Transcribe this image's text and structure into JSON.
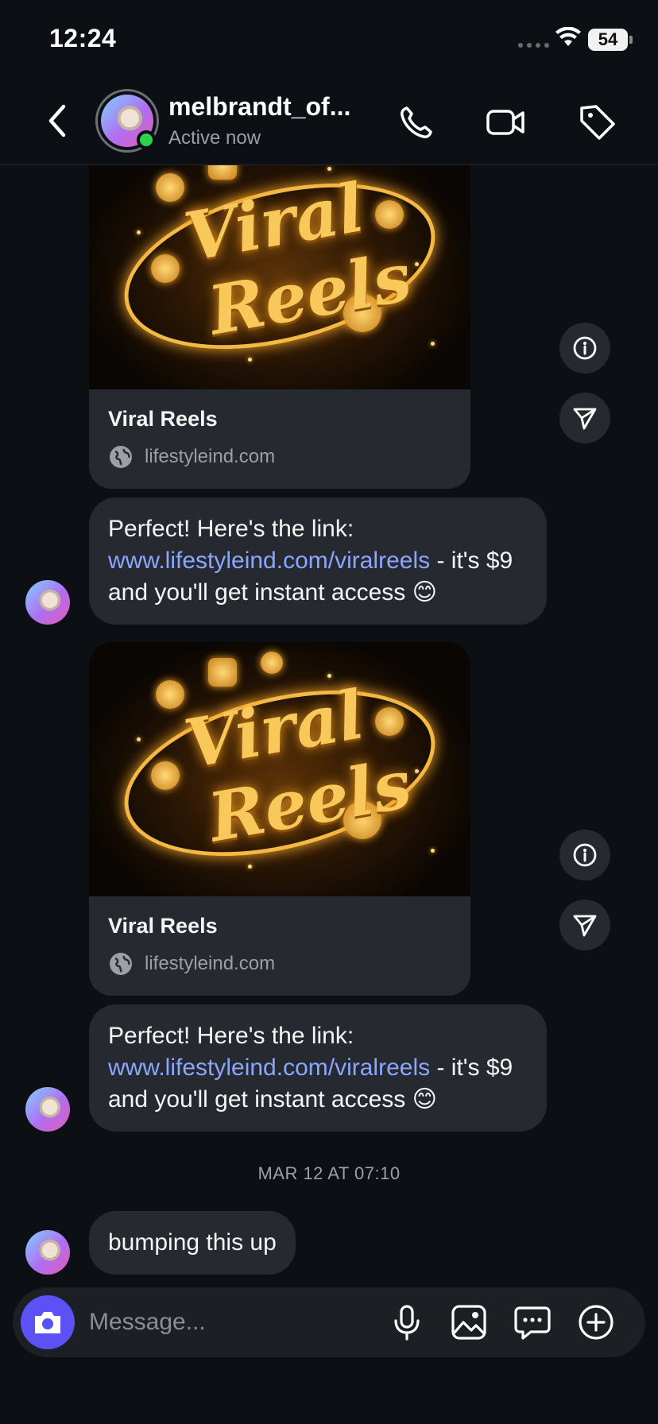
{
  "status_bar": {
    "time": "12:24",
    "battery": "54"
  },
  "header": {
    "contact_name": "melbrandt_of...",
    "contact_status": "Active now",
    "icons": [
      "back-icon",
      "phone-icon",
      "video-icon",
      "tag-icon"
    ]
  },
  "messages": [
    {
      "type": "link_card",
      "image_text": [
        "Viral",
        "Reels"
      ],
      "title": "Viral Reels",
      "domain": "lifestyleind.com"
    },
    {
      "type": "text",
      "prefix": "Perfect! Here's the link: ",
      "link": "www.lifestyleind.com/viralreels",
      "suffix": " - it's $9 and you'll get instant access 😊"
    },
    {
      "type": "link_card",
      "image_text": [
        "Viral",
        "Reels"
      ],
      "title": "Viral Reels",
      "domain": "lifestyleind.com"
    },
    {
      "type": "text",
      "prefix": "Perfect! Here's the link: ",
      "link": "www.lifestyleind.com/viralreels",
      "suffix": " - it's $9 and you'll get instant access 😊"
    },
    {
      "type": "timestamp",
      "text": "MAR 12 AT 07:10"
    },
    {
      "type": "text",
      "text": "bumping this up"
    }
  ],
  "composer": {
    "placeholder": "Message...",
    "icons": [
      "camera-icon",
      "microphone-icon",
      "gallery-icon",
      "sticker-chat-icon",
      "add-icon"
    ]
  },
  "colors": {
    "background": "#0c1014",
    "bubble": "#262a30",
    "link": "#8ba6ff",
    "camera_button": "#5b51f5",
    "online": "#2bd24b"
  }
}
